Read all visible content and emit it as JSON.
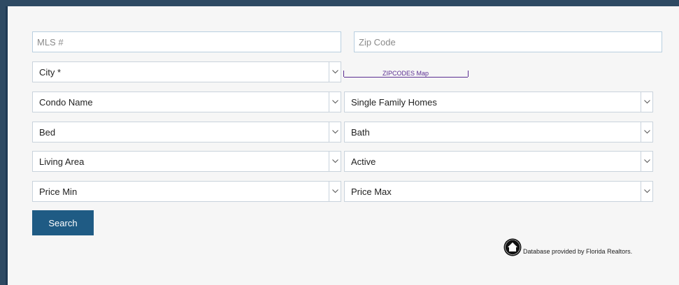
{
  "form": {
    "mls": {
      "placeholder": "MLS #",
      "value": ""
    },
    "zip": {
      "placeholder": "Zip Code",
      "value": ""
    },
    "city": {
      "selected": "City *"
    },
    "zip_map_link": "ZIPCODES Map",
    "condo": {
      "selected": "Condo Name"
    },
    "property_type": {
      "selected": "Single Family Homes"
    },
    "bed": {
      "selected": "Bed"
    },
    "bath": {
      "selected": "Bath"
    },
    "living_area": {
      "selected": "Living Area"
    },
    "status": {
      "selected": "Active"
    },
    "price_min": {
      "selected": "Price Min"
    },
    "price_max": {
      "selected": "Price Max"
    },
    "search_label": "Search"
  },
  "footer": {
    "credit": "Database provided by Florida Realtors.",
    "logo_icon": "florida-realtors-logo-icon"
  },
  "colors": {
    "background": "#f6f6f6",
    "frame": "#2e4a63",
    "button": "#1f5b84",
    "link": "#5a2d91"
  }
}
